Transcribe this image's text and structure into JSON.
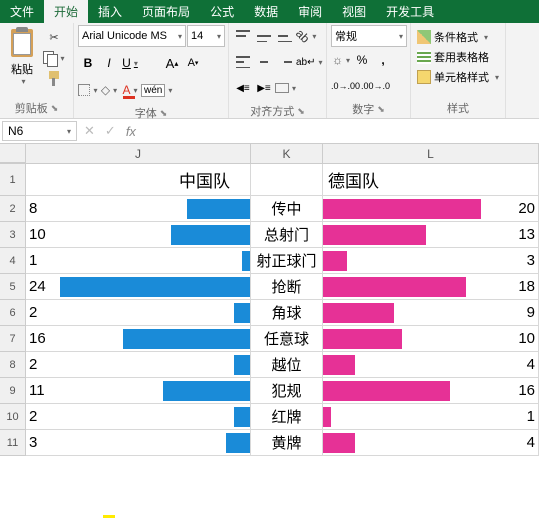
{
  "menu": {
    "file": "文件",
    "home": "开始",
    "insert": "插入",
    "page_layout": "页面布局",
    "formulas": "公式",
    "data": "数据",
    "review": "审阅",
    "view": "视图",
    "developer": "开发工具"
  },
  "ribbon": {
    "clipboard": {
      "label": "剪贴板",
      "paste": "粘贴"
    },
    "font": {
      "label": "字体",
      "name": "Arial Unicode MS",
      "size": "14",
      "bold": "B",
      "italic": "I",
      "underline": "U",
      "wen": "wén"
    },
    "alignment": {
      "label": "对齐方式"
    },
    "number": {
      "label": "数字",
      "format": "常规"
    },
    "styles": {
      "label": "样式",
      "conditional": "条件格式",
      "table": "套用表格格",
      "cell": "单元格样式"
    }
  },
  "formula_bar": {
    "name_box": "N6",
    "fx": "fx"
  },
  "columns": [
    "J",
    "K",
    "L"
  ],
  "headers": {
    "j": "中国队",
    "l": "德国队"
  },
  "chart_data": {
    "type": "bar",
    "title": "",
    "series": [
      {
        "name": "中国队",
        "values": [
          8,
          10,
          1,
          24,
          2,
          16,
          2,
          11,
          2,
          3
        ]
      },
      {
        "name": "德国队",
        "values": [
          20,
          13,
          3,
          18,
          9,
          10,
          4,
          16,
          1,
          4
        ]
      }
    ],
    "categories": [
      "传中",
      "总射门",
      "射正球门",
      "抢断",
      "角球",
      "任意球",
      "越位",
      "犯规",
      "红牌",
      "黄牌"
    ],
    "max": 24
  }
}
